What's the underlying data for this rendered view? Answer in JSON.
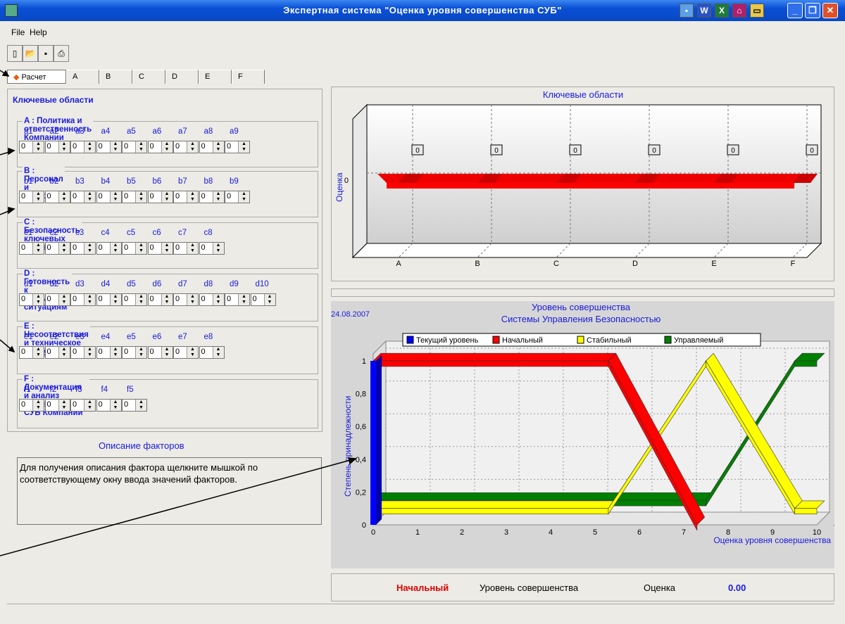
{
  "window": {
    "title": "Экспертная система \"Оценка уровня совершенства  СУБ\""
  },
  "menu": {
    "file": "File",
    "help": "Help"
  },
  "tabs": [
    {
      "label": "Расчет",
      "active": true
    },
    {
      "label": "A"
    },
    {
      "label": "B"
    },
    {
      "label": "C"
    },
    {
      "label": "D"
    },
    {
      "label": "E"
    },
    {
      "label": "F"
    }
  ],
  "key_areas": {
    "title": "Ключевые области",
    "groups": [
      {
        "title": "A : Политика и ответственность Компании",
        "factors": [
          "a1",
          "a2",
          "a3",
          "a4",
          "a5",
          "a6",
          "a7",
          "a8",
          "a9"
        ],
        "values": [
          "0",
          "0",
          "0",
          "0",
          "0",
          "0",
          "0",
          "0",
          "0"
        ]
      },
      {
        "title": "B : Персонал и Ресурсы",
        "factors": [
          "b1",
          "b2",
          "b3",
          "b4",
          "b5",
          "b6",
          "b7",
          "b8",
          "b9"
        ],
        "values": [
          "0",
          "0",
          "0",
          "0",
          "0",
          "0",
          "0",
          "0",
          "0"
        ]
      },
      {
        "title": "C : Безопасность ключевых операций",
        "factors": [
          "c1",
          "c2",
          "c3",
          "c4",
          "c5",
          "c6",
          "c7",
          "c8"
        ],
        "values": [
          "0",
          "0",
          "0",
          "0",
          "0",
          "0",
          "0",
          "0"
        ]
      },
      {
        "title": "D : Готовность к аварийным ситуациям",
        "factors": [
          "d1",
          "d2",
          "d3",
          "d4",
          "d5",
          "d6",
          "d7",
          "d8",
          "d9",
          "d10"
        ],
        "values": [
          "0",
          "0",
          "0",
          "0",
          "0",
          "0",
          "0",
          "0",
          "0",
          "0"
        ]
      },
      {
        "title": "E : Несоответствия и техническое обслуживание",
        "factors": [
          "e1",
          "e2",
          "e3",
          "e4",
          "e5",
          "e6",
          "e7",
          "e8"
        ],
        "values": [
          "0",
          "0",
          "0",
          "0",
          "0",
          "0",
          "0",
          "0"
        ]
      },
      {
        "title": "F : Документация и анализ эффективности СУБ Компании",
        "factors": [
          "f1",
          "f2",
          "f3",
          "f4",
          "f5"
        ],
        "values": [
          "0",
          "0",
          "0",
          "0",
          "0"
        ]
      }
    ]
  },
  "description": {
    "title": "Описание факторов",
    "text": "Для получения описания фактора щелкните мышкой по соответствующему окну ввода значений факторов."
  },
  "chart_data": [
    {
      "type": "bar",
      "title": "Ключевые области",
      "ylabel": "Оценка",
      "xlabel": "",
      "categories": [
        "A",
        "B",
        "C",
        "D",
        "E",
        "F"
      ],
      "values": [
        0,
        0,
        0,
        0,
        0,
        0
      ],
      "data_labels": [
        "0",
        "0",
        "0",
        "0",
        "0",
        "0"
      ],
      "y_tick_labels": [
        "0"
      ],
      "color": "#ff0000",
      "grid": true
    },
    {
      "type": "line",
      "date": "24.08.2007",
      "title": "Уровень совершенства",
      "subtitle": "Системы Управления Безопасностью",
      "xlabel": "Оценка уровня совершенства",
      "ylabel": "Степень принадлежности",
      "xlim": [
        0,
        10
      ],
      "ylim": [
        0,
        1
      ],
      "x_ticks": [
        "0",
        "1",
        "2",
        "3",
        "4",
        "5",
        "6",
        "7",
        "8",
        "9",
        "10"
      ],
      "y_ticks": [
        "0",
        "0,2",
        "0,4",
        "0,6",
        "0,8",
        "1"
      ],
      "x_clipped_label": "Те",
      "legend": "top",
      "series": [
        {
          "name": "Текущий уровень",
          "color": "#0000ff",
          "x": [
            0,
            0
          ],
          "y": [
            0,
            1
          ]
        },
        {
          "name": "Начальный",
          "color": "#ff0000",
          "x": [
            0,
            5.3,
            7.3
          ],
          "y": [
            1,
            1,
            0
          ]
        },
        {
          "name": "Стабильный",
          "color": "#ffff00",
          "x": [
            0,
            5.3,
            7.5,
            9.5,
            10
          ],
          "y": [
            0.1,
            0.1,
            1,
            0.1,
            0.1
          ]
        },
        {
          "name": "Управляемый",
          "color": "#008000",
          "x": [
            0,
            7.5,
            9.5,
            10
          ],
          "y": [
            0.15,
            0.15,
            1,
            1
          ]
        }
      ]
    }
  ],
  "status": {
    "level_value": "Начальный",
    "level_label": "Уровень совершенства",
    "score_label": "Оценка",
    "score_value": "0.00"
  }
}
